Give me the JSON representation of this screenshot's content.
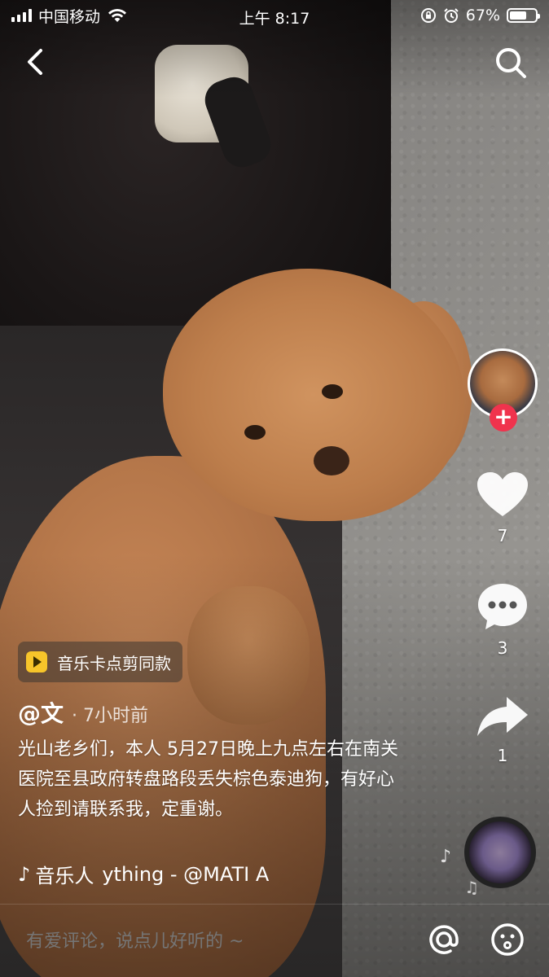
{
  "status_bar": {
    "carrier": "中国移动",
    "time": "上午 8:17",
    "battery": "67%",
    "battery_level": 0.67,
    "icons": [
      "signal-icon",
      "wifi-icon",
      "orientation-lock-icon",
      "alarm-icon",
      "battery-icon"
    ]
  },
  "nav": {
    "icons": [
      "back-icon",
      "search-icon"
    ]
  },
  "rail": {
    "like_count": "7",
    "comment_count": "3",
    "share_count": "1",
    "follow_symbol": "+",
    "accent": "#f0334d"
  },
  "post": {
    "tag": "音乐卡点剪同款",
    "author": "@文",
    "time": "· 7小时前",
    "caption": "光山老乡们，本人 5月27日晚上九点左右在南关医院至县政府转盘路段丢失棕色泰迪狗，有好心人捡到请联系我，定重谢。",
    "music_name": "音乐人",
    "music_track": "ything - @MATI    A"
  },
  "comment_bar": {
    "placeholder": "有爱评论，说点儿好听的 ~"
  }
}
